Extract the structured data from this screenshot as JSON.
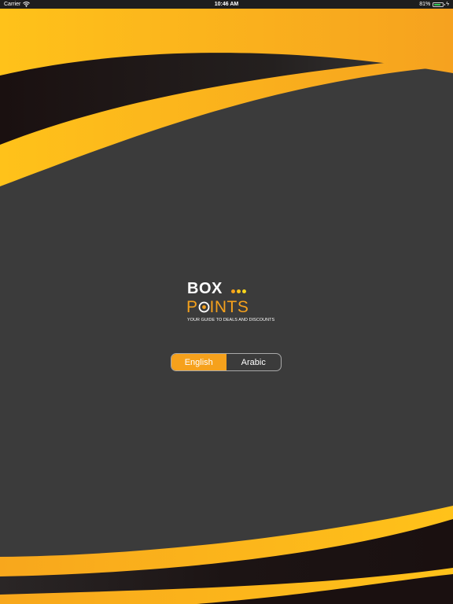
{
  "status_bar": {
    "carrier": "Carrier",
    "time": "10:46 AM",
    "battery_text": "81%",
    "battery_level": 0.81,
    "icons": [
      "wifi-icon",
      "battery-icon",
      "charging-icon"
    ]
  },
  "logo": {
    "line1": "BOX",
    "line2_prefix": "P",
    "line2_suffix": "INTS",
    "tagline": "YOUR GUIDE TO DEALS AND DISCOUNTS",
    "dot_colors": [
      "#f5a11c",
      "#f9c21a",
      "#f7d51c"
    ]
  },
  "language_toggle": {
    "options": [
      "English",
      "Arabic"
    ],
    "selected": "English"
  },
  "colors": {
    "accent": "#f6a11c",
    "brand_yellow": "#ffc21a",
    "background": "#3b3b3b",
    "dark_wave": "#1c1414"
  }
}
